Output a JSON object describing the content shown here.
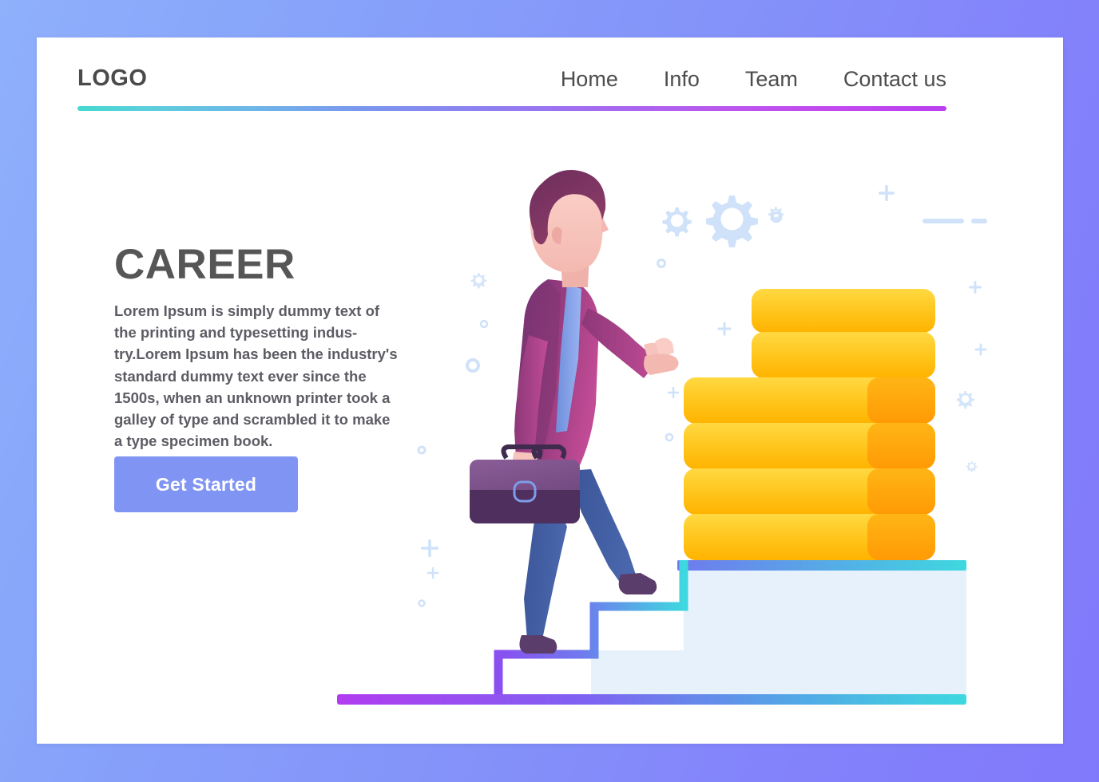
{
  "page": {
    "background_gradient_from": "#8fb0fb",
    "background_gradient_to": "#8179fb",
    "card_background": "#ffffff"
  },
  "header": {
    "logo": "LOGO",
    "rule_gradient_from": "#44d8d0",
    "rule_gradient_to": "#b93ff0",
    "nav": [
      {
        "label": "Home"
      },
      {
        "label": "Info"
      },
      {
        "label": "Team"
      },
      {
        "label": "Contact us"
      }
    ]
  },
  "hero": {
    "headline": "CAREER",
    "body": "Lorem Ipsum is simply dummy text of\nthe printing and typesetting indus-\ntry.Lorem Ipsum has been the industry's\nstandard dummy text ever since the\n1500s, when an unknown printer took a\ngalley of type and scrambled it to make\na type specimen book.",
    "cta_label": "Get Started",
    "cta_color": "#8094f4",
    "headline_color": "#565656",
    "body_color": "#5c5c64"
  },
  "illustration": {
    "name": "businessman-climbing-stairs-to-coin-stacks",
    "colors": {
      "jacket_light": "#b8468f",
      "jacket_dark": "#6d3070",
      "hair": "#7a3360",
      "skin": "#f7c4bd",
      "tie": "#7e9de8",
      "trousers": "#3f5a9d",
      "shoes": "#5b3d6b",
      "briefcase_top": "#7a5287",
      "briefcase_bottom": "#4e2f5e",
      "coin_light": "#ffd43c",
      "coin_mid": "#ffc107",
      "coin_dark": "#ffa50a",
      "step_fill": "#e6f1fb",
      "step_edge_from": "#8a4ff0",
      "step_edge_to": "#3ed8e0",
      "ground_from": "#b13cf0",
      "ground_to": "#3ed8e0",
      "decor": "#cfe2f9"
    },
    "decor_items": [
      "gear-large",
      "gear-medium",
      "gear-small",
      "circle-outline",
      "plus-mark",
      "dash-mark"
    ]
  }
}
